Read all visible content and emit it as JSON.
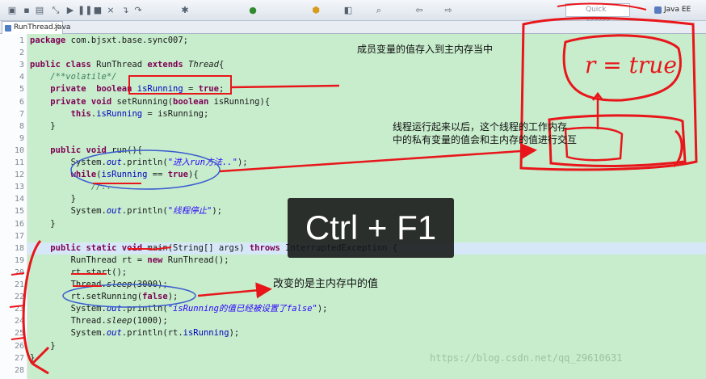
{
  "window": {
    "tab_title": "RunThread.java"
  },
  "toolbar": {
    "quick_access": "Quick Access",
    "perspective": "Java EE"
  },
  "code_lines": [
    {
      "n": "1",
      "html": "<span class=\"kw\">package</span> com.bjsxt.base.sync007;"
    },
    {
      "n": "2",
      "html": ""
    },
    {
      "n": "3",
      "html": "<span class=\"kw\">public class</span> RunThread <span class=\"kw\">extends</span> <span class=\"itl\">Thread</span>{"
    },
    {
      "n": "4",
      "html": "    <span class=\"cmt\">/**volatile*/</span>"
    },
    {
      "n": "5",
      "html": "    <span class=\"kw\">private  boolean</span> <span class=\"fld\">isRunning</span> = <span class=\"kw\">true</span>;"
    },
    {
      "n": "6",
      "html": "    <span class=\"kw\">private void</span> setRunning(<span class=\"kw\">boolean</span> isRunning){"
    },
    {
      "n": "7",
      "html": "        <span class=\"kw\">this</span>.<span class=\"fld\">isRunning</span> = isRunning;"
    },
    {
      "n": "8",
      "html": "    }"
    },
    {
      "n": "9",
      "html": ""
    },
    {
      "n": "10",
      "html": "    <span class=\"kw\">public void</span> run(){"
    },
    {
      "n": "11",
      "html": "        System.<span class=\"fld itl\">out</span>.println(<span class=\"str\">\"进入run方法..\"</span>);"
    },
    {
      "n": "12",
      "html": "        <span class=\"kw\">while</span>(<span class=\"fld\">isRunning</span> == <span class=\"kw\">true</span>){"
    },
    {
      "n": "13",
      "html": "            <span class=\"cmt\">//..</span>"
    },
    {
      "n": "14",
      "html": "        }"
    },
    {
      "n": "15",
      "html": "        System.<span class=\"fld itl\">out</span>.println(<span class=\"str\">\"线程停止\"</span>);"
    },
    {
      "n": "16",
      "html": "    }"
    },
    {
      "n": "17",
      "html": ""
    },
    {
      "n": "18",
      "html": "    <span class=\"kw\">public static void</span> main(String[] args) <span class=\"kw\">throws</span> InterruptedException {"
    },
    {
      "n": "19",
      "html": "        RunThread rt = <span class=\"kw\">new</span> RunThread();"
    },
    {
      "n": "20",
      "html": "        rt.start();"
    },
    {
      "n": "21",
      "html": "        Thread.<span class=\"itl\">sleep</span>(3000);"
    },
    {
      "n": "22",
      "html": "        rt.setRunning(<span class=\"kw\">false</span>);"
    },
    {
      "n": "23",
      "html": "        System.<span class=\"fld itl\">out</span>.println(<span class=\"str\">\"isRunning的值已经被设置了false\"</span>);"
    },
    {
      "n": "24",
      "html": "        Thread.<span class=\"itl\">sleep</span>(1000);"
    },
    {
      "n": "25",
      "html": "        System.<span class=\"fld itl\">out</span>.println(rt.<span class=\"fld\">isRunning</span>);"
    },
    {
      "n": "26",
      "html": "    }"
    },
    {
      "n": "27",
      "html": "}"
    },
    {
      "n": "28",
      "html": ""
    }
  ],
  "highlighted_line": "18",
  "annotations": {
    "note1": "成员变量的值存入到主内存当中",
    "note2_line1": "线程运行起来以后，这个线程的工作内存",
    "note2_line2": "中的私有变量的值会和主内存的值进行交互",
    "note3": "改变的是主内存中的值",
    "memory_label": "r = true",
    "keyboard_shortcut": "Ctrl + F1",
    "watermark": "https://blog.csdn.net/qq_29610631"
  },
  "colors": {
    "editor_bg": "#c7edcc",
    "ink_red": "#e8161b",
    "ink_blue": "#3a5bd0"
  }
}
